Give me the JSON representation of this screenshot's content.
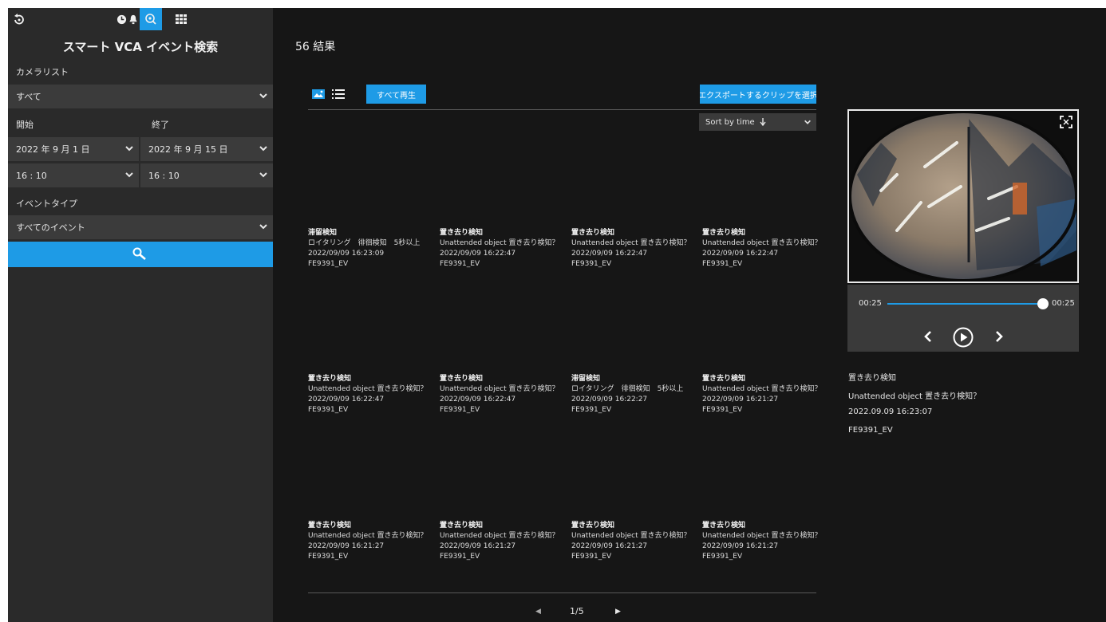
{
  "sidebar": {
    "top_icons": [
      "back-icon",
      "clock-icon",
      "bell-icon",
      "smart-search-icon",
      "grid-icon"
    ],
    "title": "スマート VCA イベント検索",
    "camera_list_label": "カメラリスト",
    "camera_value": "すべて",
    "start_label": "開始",
    "end_label": "終了",
    "start_date": "2022 年 9 月 1 日",
    "end_date": "2022 年 9 月 15 日",
    "start_time": "16 : 10",
    "end_time": "16 : 10",
    "event_type_label": "イベントタイプ",
    "event_type_value": "すべてのイベント",
    "search_icon": "search-icon",
    "accent_color": "#1e9be6"
  },
  "main": {
    "results_title": "56 結果",
    "play_all_label": "すべて再生",
    "export_label": "エクスポートするクリップを選択",
    "sort_label": "Sort by time",
    "cards": [
      {
        "title": "滞留検知",
        "desc": "ロイタリング　徘徊検知　5秒以上",
        "time": "2022/09/09 16:23:09",
        "camera": "FE9391_EV"
      },
      {
        "title": "置き去り検知",
        "desc": "Unattended object 置き去り検知？",
        "time": "2022/09/09 16:22:47",
        "camera": "FE9391_EV"
      },
      {
        "title": "置き去り検知",
        "desc": "Unattended object 置き去り検知？",
        "time": "2022/09/09 16:22:47",
        "camera": "FE9391_EV"
      },
      {
        "title": "置き去り検知",
        "desc": "Unattended object 置き去り検知？",
        "time": "2022/09/09 16:22:47",
        "camera": "FE9391_EV"
      },
      {
        "title": "置き去り検知",
        "desc": "Unattended object 置き去り検知？",
        "time": "2022/09/09 16:22:47",
        "camera": "FE9391_EV"
      },
      {
        "title": "置き去り検知",
        "desc": "Unattended object 置き去り検知？",
        "time": "2022/09/09 16:22:47",
        "camera": "FE9391_EV"
      },
      {
        "title": "滞留検知",
        "desc": "ロイタリング　徘徊検知　5秒以上",
        "time": "2022/09/09 16:22:27",
        "camera": "FE9391_EV"
      },
      {
        "title": "置き去り検知",
        "desc": "Unattended object 置き去り検知？",
        "time": "2022/09/09 16:21:27",
        "camera": "FE9391_EV"
      },
      {
        "title": "置き去り検知",
        "desc": "Unattended object 置き去り検知？",
        "time": "2022/09/09 16:21:27",
        "camera": "FE9391_EV"
      },
      {
        "title": "置き去り検知",
        "desc": "Unattended object 置き去り検知？",
        "time": "2022/09/09 16:21:27",
        "camera": "FE9391_EV"
      },
      {
        "title": "置き去り検知",
        "desc": "Unattended object 置き去り検知？",
        "time": "2022/09/09 16:21:27",
        "camera": "FE9391_EV"
      },
      {
        "title": "置き去り検知",
        "desc": "Unattended object 置き去り検知？",
        "time": "2022/09/09 16:21:27",
        "camera": "FE9391_EV"
      }
    ],
    "pagination": {
      "current": "1/5"
    }
  },
  "preview": {
    "time_current": "00:25",
    "time_total": "00:25",
    "progress": 1.0,
    "title": "置き去り検知",
    "desc": "Unattended object 置き去り検知？",
    "datetime": "2022.09.09 16:23:07",
    "camera": "FE9391_EV"
  }
}
